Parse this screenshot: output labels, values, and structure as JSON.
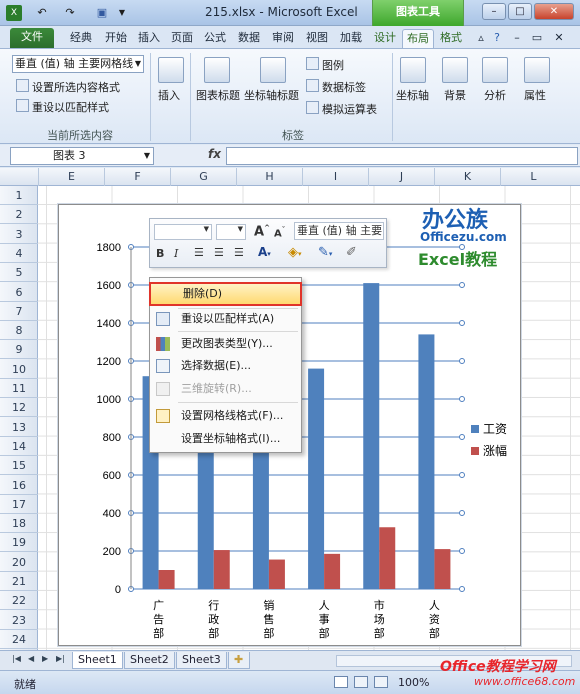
{
  "window": {
    "title": "215.xlsx - Microsoft Excel",
    "context_tool": "图表工具"
  },
  "tabs": [
    "文件",
    "经典",
    "开始",
    "插入",
    "页面",
    "公式",
    "数据",
    "审阅",
    "视图",
    "加载",
    "设计",
    "布局",
    "格式"
  ],
  "ribbon": {
    "selection_combo": "垂直 (值) 轴 主要网格线",
    "format_selection": "设置所选内容格式",
    "reset_match_style": "重设以匹配样式",
    "group_current_selection": "当前所选内容",
    "insert": "插入",
    "chart_title": "图表标题",
    "axis_title": "坐标轴标题",
    "legend": "图例",
    "data_labels": "数据标签",
    "data_table": "模拟运算表",
    "group_labels": "标签",
    "axes": "坐标轴",
    "background": "背景",
    "analysis": "分析",
    "properties": "属性"
  },
  "formula_bar": {
    "name_box": "图表 3",
    "fx": "fx"
  },
  "columns": [
    "E",
    "F",
    "G",
    "H",
    "I",
    "J",
    "K",
    "L"
  ],
  "rows": [
    "1",
    "2",
    "3",
    "4",
    "5",
    "6",
    "7",
    "8",
    "9",
    "10",
    "11",
    "12",
    "13",
    "14",
    "15",
    "16",
    "17",
    "18",
    "19",
    "20",
    "21",
    "22",
    "23",
    "24"
  ],
  "mini_toolbar": {
    "element_combo": "垂直 (值) 轴 主要",
    "bold": "B",
    "italic": "I"
  },
  "logo": {
    "brand": "办公族",
    "domain": "Officezu.com",
    "tagline": "Excel教程"
  },
  "context_menu": [
    {
      "label": "删除(D)",
      "highlighted": true,
      "enabled": true
    },
    {
      "label": "重设以匹配样式(A)",
      "enabled": true
    },
    {
      "label": "更改图表类型(Y)...",
      "enabled": true
    },
    {
      "label": "选择数据(E)...",
      "enabled": true
    },
    {
      "label": "三维旋转(R)...",
      "enabled": false
    },
    {
      "label": "设置网格线格式(F)...",
      "enabled": true
    },
    {
      "label": "设置坐标轴格式(I)...",
      "enabled": true
    }
  ],
  "sheets": [
    "Sheet1",
    "Sheet2",
    "Sheet3"
  ],
  "status": {
    "ready": "就绪",
    "zoom": "100%"
  },
  "watermark": {
    "main": "Office教程学习网",
    "url": "www.office68.com"
  },
  "colors": {
    "series_salary": "#4f81bd",
    "series_raise": "#c0504d",
    "context_tab": "#4aa83a",
    "menu_highlight_border": "#e0342a"
  },
  "chart_data": {
    "type": "bar",
    "categories": [
      "广告部",
      "行政部",
      "销售部",
      "人事部",
      "市场部",
      "人资部"
    ],
    "series": [
      {
        "name": "工资",
        "values": [
          1120,
          1000,
          1050,
          1160,
          1610,
          1340
        ]
      },
      {
        "name": "涨幅",
        "values": [
          100,
          205,
          155,
          185,
          325,
          210
        ]
      }
    ],
    "ylim": [
      0,
      1800
    ],
    "yticks": [
      "0",
      "200",
      "400",
      "600",
      "800",
      "1000",
      "1200",
      "1400",
      "1600",
      "1800"
    ],
    "grid": true,
    "legend": "right"
  }
}
